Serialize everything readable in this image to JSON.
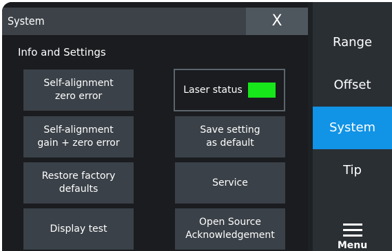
{
  "dialog": {
    "title": "System",
    "close_label": "X",
    "section_heading": "Info and Settings",
    "left_buttons": [
      {
        "line1": "Self-alignment",
        "line2": "zero error"
      },
      {
        "line1": "Self-alignment",
        "line2": "gain + zero error"
      },
      {
        "line1": "Restore factory",
        "line2": "defaults"
      },
      {
        "line1": "Display test",
        "line2": ""
      }
    ],
    "laser_status_label": "Laser status",
    "right_buttons": [
      {
        "line1": "Save setting",
        "line2": "as default"
      },
      {
        "line1": "Service",
        "line2": ""
      },
      {
        "line1": "Open Source",
        "line2": "Acknowledgement"
      }
    ]
  },
  "sidebar": {
    "items": [
      {
        "label": "Range"
      },
      {
        "label": "Offset"
      },
      {
        "label": "System"
      },
      {
        "label": "Tip"
      }
    ],
    "active": "System",
    "menu_label": "Menu"
  },
  "colors": {
    "accent": "#1193e6",
    "laser_ok": "#17e61a",
    "button_bg": "#3a4148"
  }
}
